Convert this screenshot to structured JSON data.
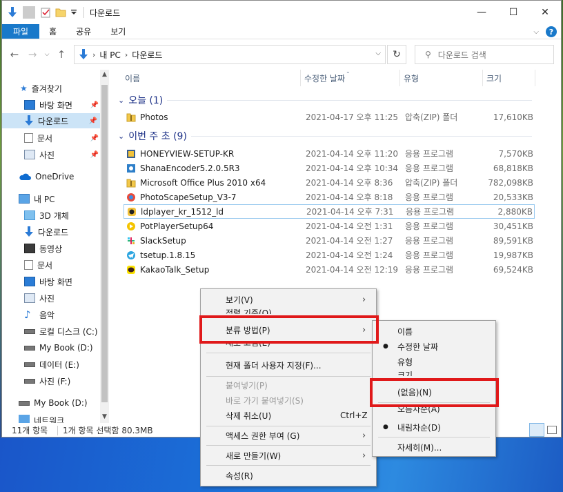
{
  "window": {
    "title": "다운로드",
    "controls": {
      "minimize": "—",
      "maximize": "☐",
      "close": "✕"
    }
  },
  "ribbon": {
    "tabs": [
      "파일",
      "홈",
      "공유",
      "보기"
    ],
    "help": "?"
  },
  "address": {
    "crumbs": [
      "내 PC",
      "다운로드"
    ],
    "search_placeholder": "다운로드 검색"
  },
  "sidebar": {
    "quick_access": "즐겨찾기",
    "quick_items": [
      "바탕 화면",
      "다운로드",
      "문서",
      "사진"
    ],
    "onedrive": "OneDrive",
    "this_pc": "내 PC",
    "pc_items": [
      "3D 개체",
      "다운로드",
      "동영상",
      "문서",
      "바탕 화면",
      "사진",
      "음악",
      "로컬 디스크 (C:)",
      "My Book (D:)",
      "데이터 (E:)",
      "사진 (F:)"
    ],
    "extra_drive": "My Book (D:)",
    "partial": "네트워크"
  },
  "columns": {
    "name": "이름",
    "modified": "수정한 날짜",
    "type": "유형",
    "size": "크기"
  },
  "groups": {
    "today": "오늘 (1)",
    "this_week": "이번 주 초 (9)"
  },
  "files_today": [
    {
      "name": "Photos",
      "date": "2021-04-17 오후 11:25",
      "type": "압축(ZIP) 폴더",
      "size": "17,610KB",
      "icon": "zip-icon"
    }
  ],
  "files_week": [
    {
      "name": "HONEYVIEW-SETUP-KR",
      "date": "2021-04-14 오후 11:20",
      "type": "응용 프로그램",
      "size": "7,570KB",
      "icon": "honeyview-icon"
    },
    {
      "name": "ShanaEncoder5.2.0.5R3",
      "date": "2021-04-14 오후 10:34",
      "type": "응용 프로그램",
      "size": "68,818KB",
      "icon": "shana-icon"
    },
    {
      "name": "Microsoft Office Plus 2010 x64",
      "date": "2021-04-14 오후 8:36",
      "type": "압축(ZIP) 폴더",
      "size": "782,098KB",
      "icon": "zip-icon"
    },
    {
      "name": "PhotoScapeSetup_V3-7",
      "date": "2021-04-14 오후 8:18",
      "type": "응용 프로그램",
      "size": "20,533KB",
      "icon": "photoscape-icon"
    },
    {
      "name": "ldplayer_kr_1512_ld",
      "date": "2021-04-14 오후 7:31",
      "type": "응용 프로그램",
      "size": "2,880KB",
      "icon": "ldplayer-icon"
    },
    {
      "name": "PotPlayerSetup64",
      "date": "2021-04-14 오전 1:31",
      "type": "응용 프로그램",
      "size": "30,451KB",
      "icon": "potplayer-icon"
    },
    {
      "name": "SlackSetup",
      "date": "2021-04-14 오전 1:27",
      "type": "응용 프로그램",
      "size": "89,591KB",
      "icon": "slack-icon"
    },
    {
      "name": "tsetup.1.8.15",
      "date": "2021-04-14 오전 1:24",
      "type": "응용 프로그램",
      "size": "19,987KB",
      "icon": "telegram-icon"
    },
    {
      "name": "KakaoTalk_Setup",
      "date": "2021-04-14 오전 12:19",
      "type": "응용 프로그램",
      "size": "69,524KB",
      "icon": "kakaotalk-icon"
    }
  ],
  "status": {
    "count": "11개 항목",
    "selected": "1개 항목 선택함 80.3MB"
  },
  "context_menu": {
    "view": "보기(V)",
    "sort_partial": "정렬 기준(O)",
    "group_by": "분류 방법(P)",
    "refresh_partial": "새로 고침(E)",
    "customize": "현재 폴더 사용자 지정(F)...",
    "paste": "붙여넣기(P)",
    "paste_shortcut": "바로 가기 붙여넣기(S)",
    "undo": "삭제 취소(U)",
    "undo_key": "Ctrl+Z",
    "access": "액세스 권한 부여 (G)",
    "new": "새로 만들기(W)",
    "properties": "속성(R)"
  },
  "submenu": {
    "name": "이름",
    "modified": "수정한 날짜",
    "type": "유형",
    "size": "크기",
    "none": "(없음)(N)",
    "ascending": "오름차순(A)",
    "descending": "내림차순(D)",
    "more": "자세히(M)..."
  },
  "colors": {
    "accent": "#1979ca",
    "highlight": "#e0191a",
    "group_text": "#1e3287"
  }
}
